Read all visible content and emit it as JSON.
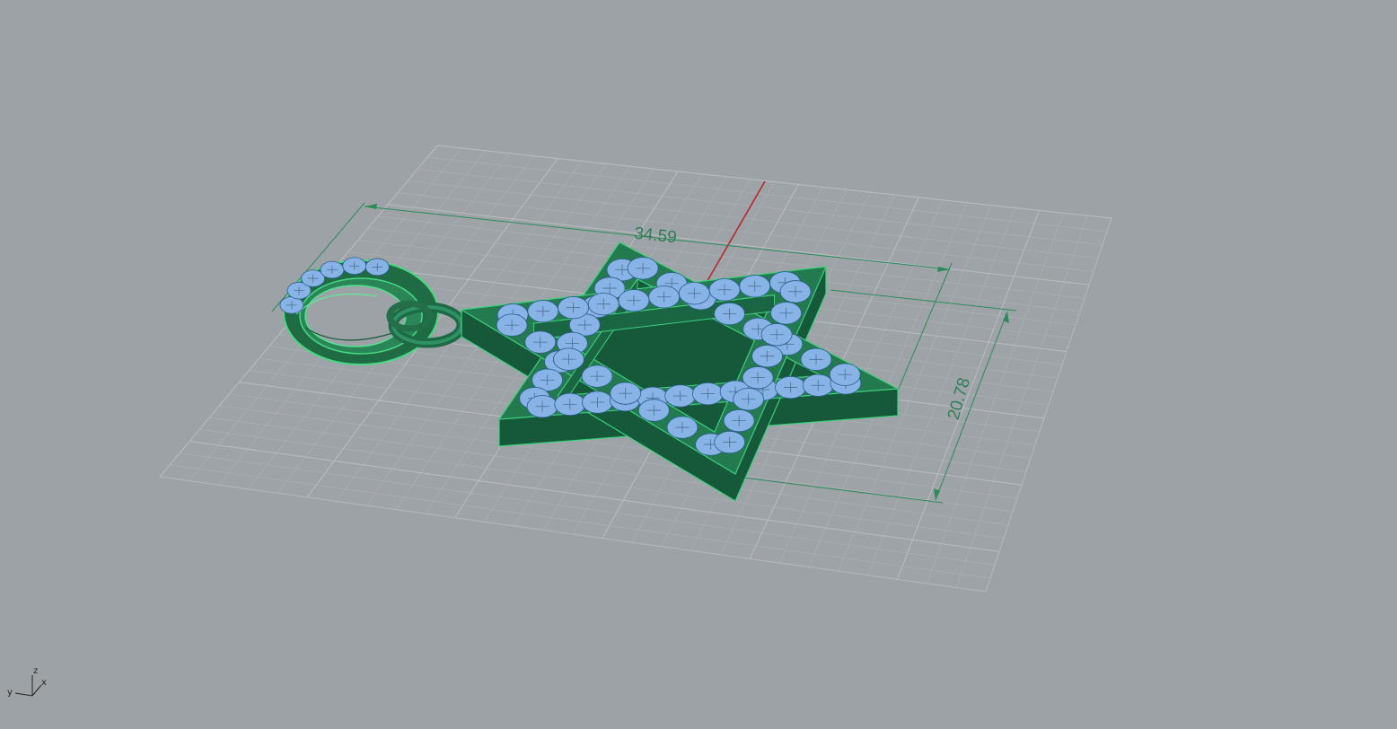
{
  "viewport": {
    "name": "perspective-viewport",
    "background": "#9da2a6",
    "grid_color": "#b4b8bb",
    "model_color": "#1f6f45",
    "model_edge_color": "#3fcf7e",
    "gem_color": "#87b3e6",
    "x_axis_color": "#b52a2a",
    "y_axis_color": "#2f9a4a"
  },
  "dimensions": {
    "width": "34.59",
    "height": "20.78"
  },
  "axis_gizmo": {
    "z": "z",
    "y": "y",
    "x": "x"
  }
}
